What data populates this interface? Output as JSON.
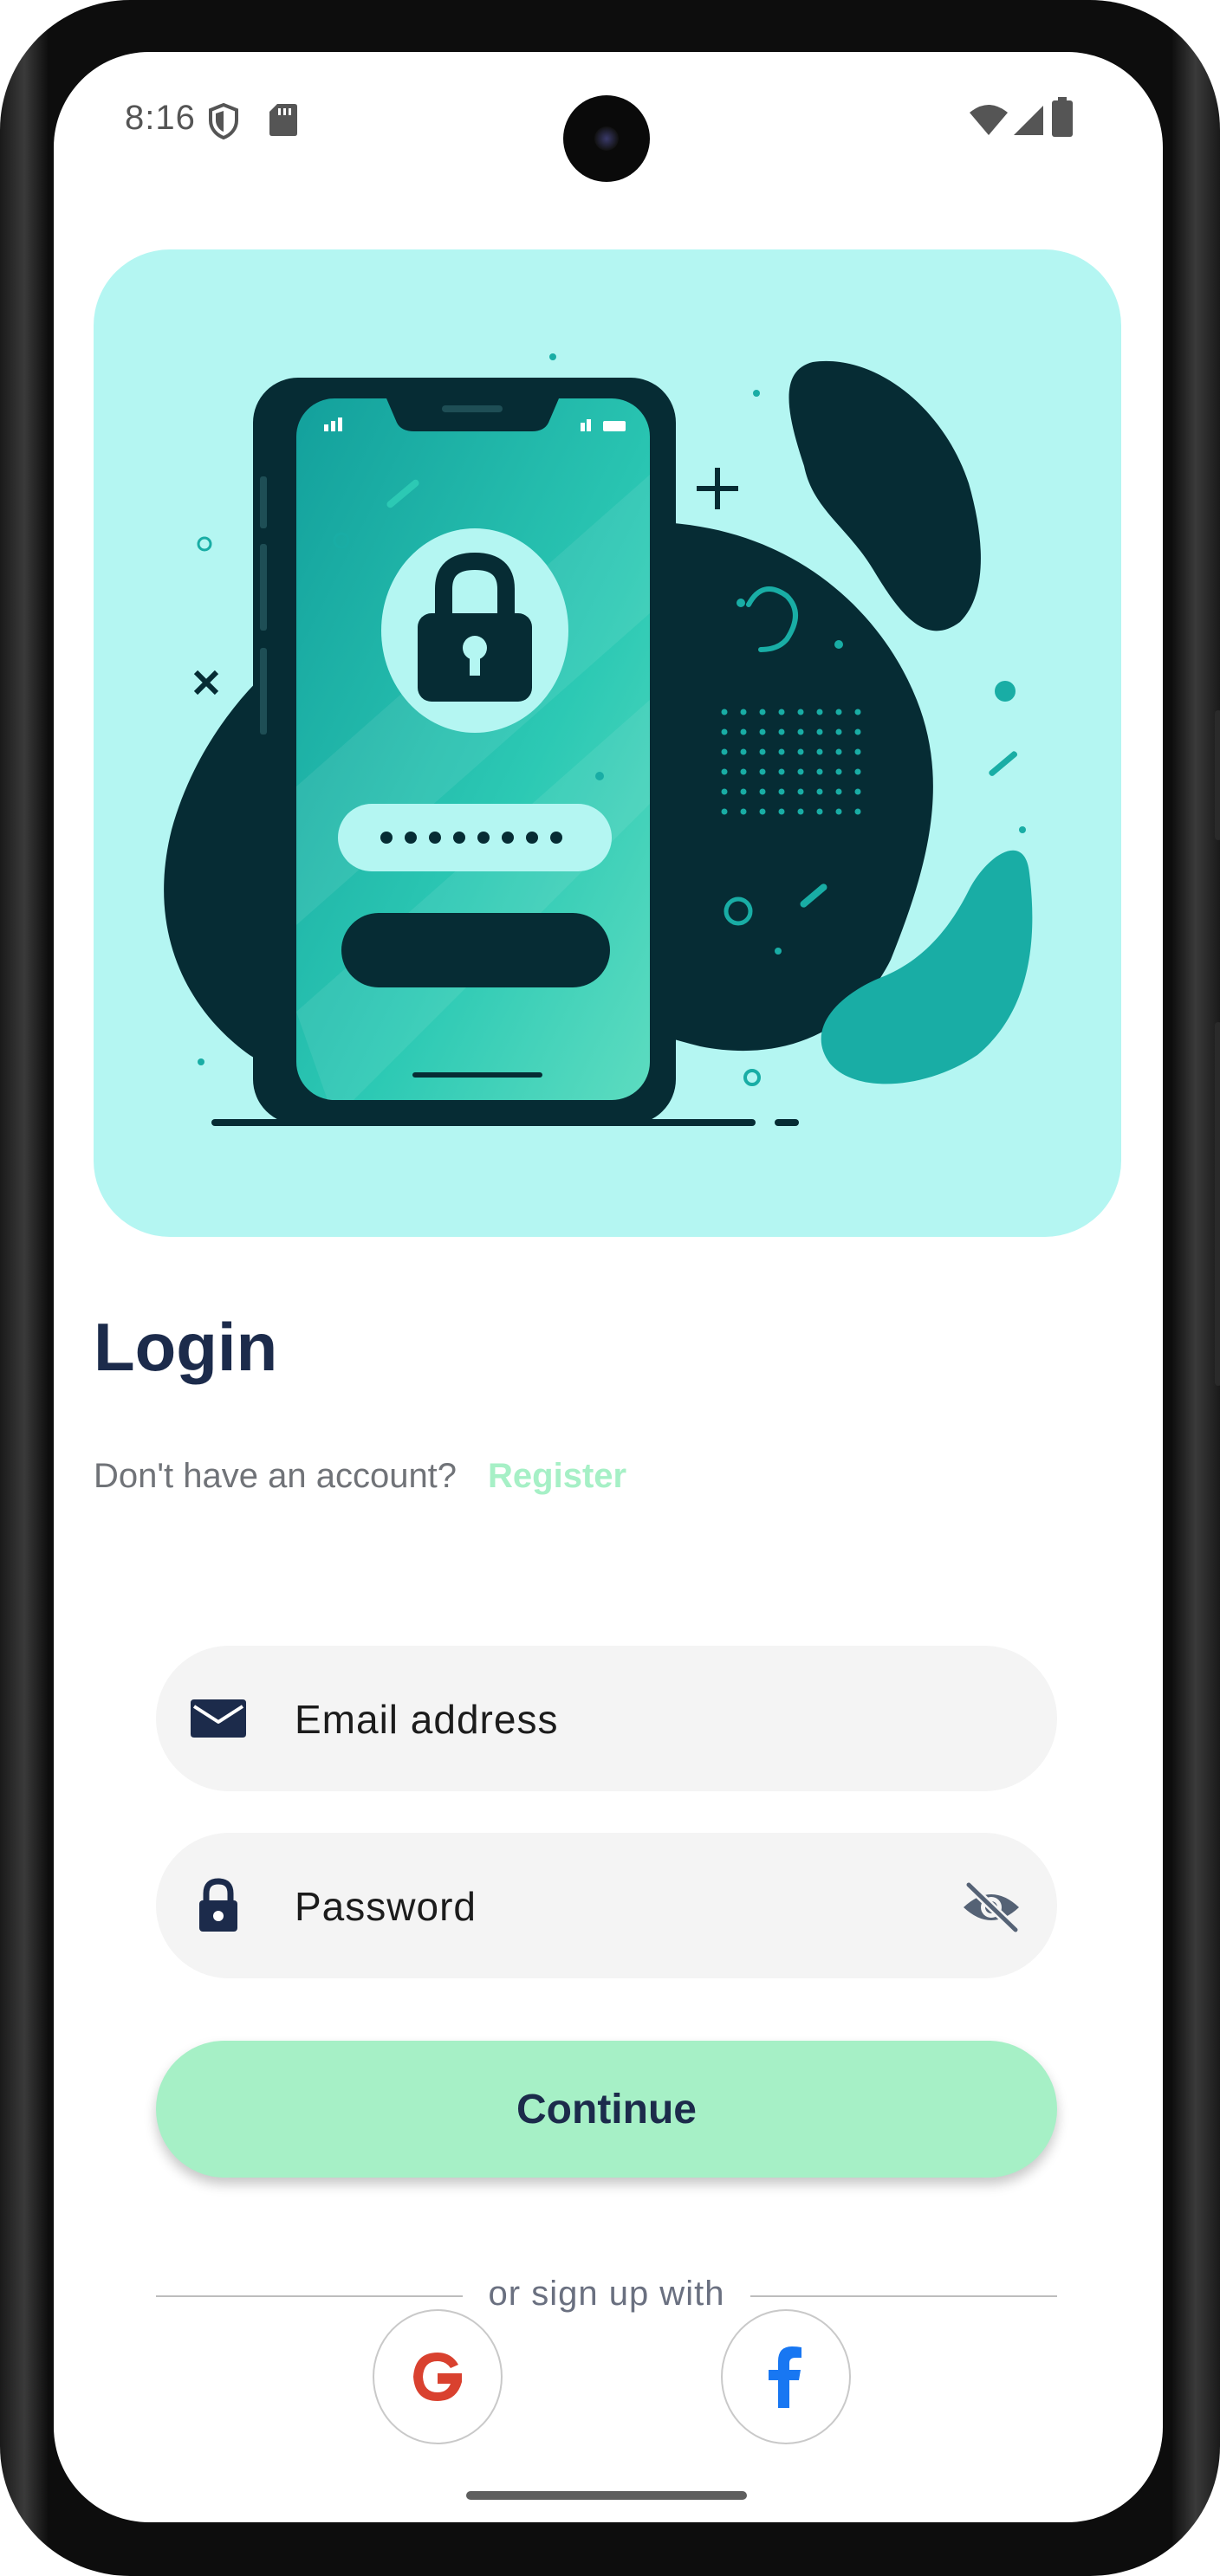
{
  "status_bar": {
    "time": "8:16",
    "left_icons": [
      "shield-icon",
      "sd-card-icon"
    ],
    "right_icons": [
      "wifi-icon",
      "cell-signal-icon",
      "battery-icon"
    ]
  },
  "login": {
    "title": "Login",
    "no_account_text": "Don't have an account?",
    "register_link": "Register"
  },
  "form": {
    "email": {
      "placeholder": "Email address",
      "value": "",
      "icon": "envelope-icon"
    },
    "password": {
      "placeholder": "Password",
      "value": "",
      "icon": "lock-icon",
      "visibility_icon": "eye-off-icon"
    },
    "continue_label": "Continue"
  },
  "social": {
    "divider_text": "or sign up with",
    "providers": [
      "google-icon",
      "facebook-icon"
    ]
  },
  "colors": {
    "primary_dark": "#1c2b4b",
    "accent_mint": "#a6f0c6",
    "hero_background": "#b4f6f2",
    "teal": "#19ada5",
    "field_background": "#f4f4f4"
  }
}
